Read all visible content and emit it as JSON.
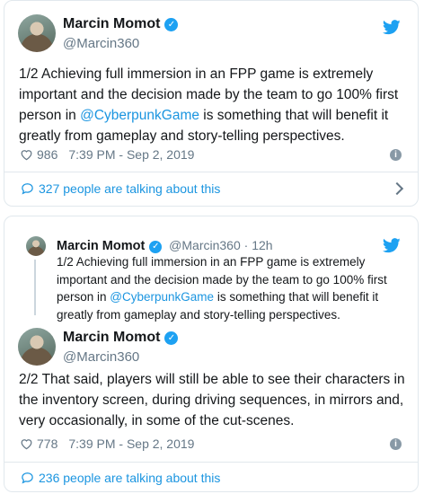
{
  "tweet1": {
    "author": "Marcin Momot",
    "handle": "@Marcin360",
    "text_before": "1/2 Achieving full immersion in an FPP game is extremely important and the decision made by the team to go 100% first person in ",
    "mention": "@CyberpunkGame",
    "text_after": " is something that will benefit it greatly from gameplay and story-telling perspectives.",
    "likes": "986",
    "timestamp": "7:39 PM - Sep 2, 2019",
    "talking": "327 people are talking about this"
  },
  "tweet2": {
    "quoted": {
      "author": "Marcin Momot",
      "handle": "@Marcin360",
      "age": "12h",
      "text_before": "1/2 Achieving full immersion in an FPP game is extremely important and the decision made by the team to go 100% first person in ",
      "mention": "@CyberpunkGame",
      "text_after": " is something that will benefit it greatly from gameplay and story-telling perspectives."
    },
    "author": "Marcin Momot",
    "handle": "@Marcin360",
    "text": "2/2 That said, players will still be able to see their characters in the inventory screen, during driving sequences, in mirrors and, very occasionally, in some of the cut-scenes.",
    "likes": "778",
    "timestamp": "7:39 PM - Sep 2, 2019",
    "talking": "236 people are talking about this"
  },
  "colors": {
    "link": "#1b95e0",
    "verified": "#1da1f2",
    "muted": "#657786",
    "border": "#e1e8ed"
  },
  "icons": [
    "verified-icon",
    "twitter-bird-icon",
    "heart-icon",
    "info-icon",
    "comment-bubble-icon",
    "chevron-right-icon"
  ]
}
